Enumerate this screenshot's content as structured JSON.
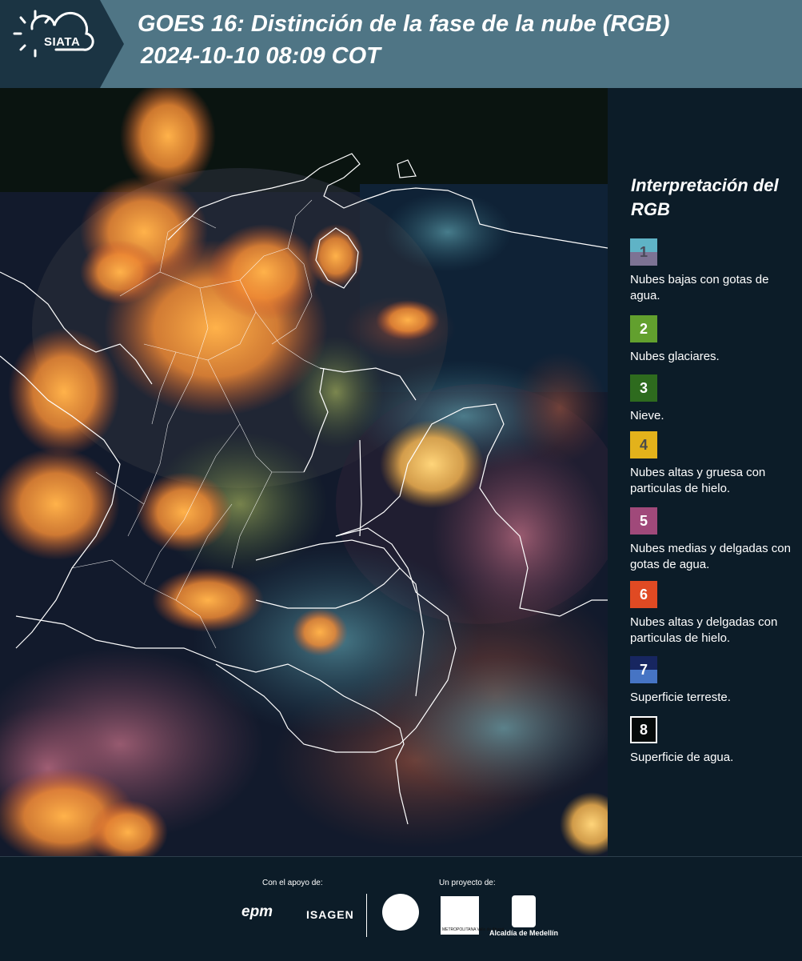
{
  "header": {
    "logo_text": "SIATA",
    "title_line1": "GOES 16: Distinción de la fase de la nube (RGB)",
    "title_line2": "2024-10-10 08:09 COT",
    "bg_color": "#4f7585",
    "logo_bg_color": "#1b3443"
  },
  "legend": {
    "title": "Interpretación del RGB",
    "items": [
      {
        "number": "1",
        "label": "Nubes bajas con gotas de agua.",
        "color_top": "#5fb3c6",
        "color_bottom": "#7d7394",
        "text_color": "#4a4a5a"
      },
      {
        "number": "2",
        "label": "Nubes glaciares.",
        "color_top": "#62a02e",
        "color_bottom": "#62a02e",
        "text_color": "#ffffff"
      },
      {
        "number": "3",
        "label": "Nieve.",
        "color_top": "#2e6b1e",
        "color_bottom": "#2e6b1e",
        "text_color": "#ffffff"
      },
      {
        "number": "4",
        "label": "Nubes altas y gruesa con particulas de hielo.",
        "color_top": "#e3b21b",
        "color_bottom": "#e3b21b",
        "text_color": "#4a4a4a"
      },
      {
        "number": "5",
        "label": "Nubes medias y delgadas con gotas de agua.",
        "color_top": "#a0497a",
        "color_bottom": "#a0497a",
        "text_color": "#ffffff"
      },
      {
        "number": "6",
        "label": "Nubes altas y delgadas con particulas de hielo.",
        "color_top": "#e04a23",
        "color_bottom": "#e04a23",
        "text_color": "#ffffff"
      },
      {
        "number": "7",
        "label": "Superficie terreste.",
        "color_top": "#172660",
        "color_bottom": "#4674c4",
        "text_color": "#ffffff"
      },
      {
        "number": "8",
        "label": "Superficie de agua.",
        "color_top": "#050a0a",
        "color_bottom": "#050a0a",
        "text_color": "#ffffff"
      }
    ]
  },
  "footer": {
    "support_label": "Con el apoyo de:",
    "support_logos": [
      "epm",
      "ISAGEN"
    ],
    "project_label": "Un proyecto de:",
    "area_logo_text": "METROPOLITANA Valle de Aburrá",
    "alcaldia_text": "Alcaldía de Medellín"
  }
}
